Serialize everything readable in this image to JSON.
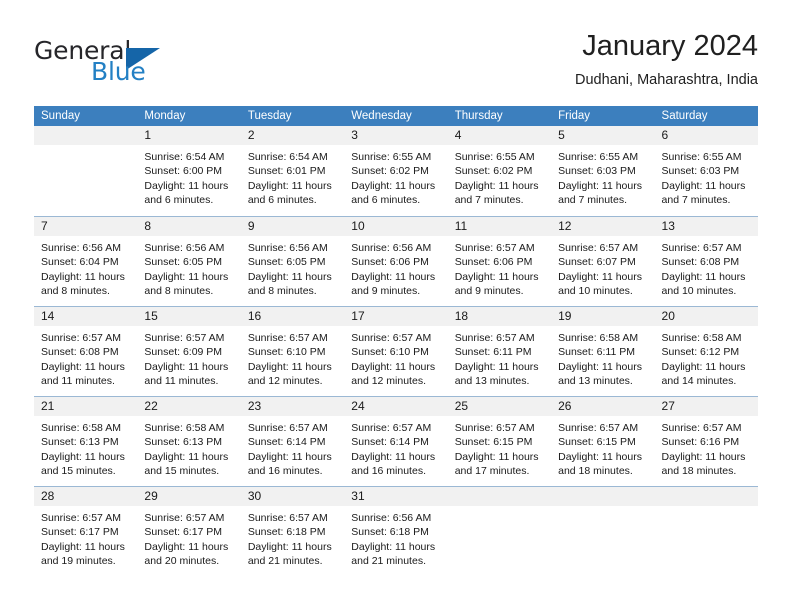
{
  "brand": {
    "name_top": "General",
    "name_bottom": "Blue",
    "accent_color": "#2380c4",
    "triangle_color": "#1565a8"
  },
  "header": {
    "title": "January 2024",
    "subtitle": "Dudhani, Maharashtra, India"
  },
  "calendar": {
    "header_bg": "#3c7fbe",
    "day_band_bg": "#f1f1f1",
    "weekdays": [
      "Sunday",
      "Monday",
      "Tuesday",
      "Wednesday",
      "Thursday",
      "Friday",
      "Saturday"
    ],
    "weeks": [
      [
        {
          "day": "",
          "lines": []
        },
        {
          "day": "1",
          "lines": [
            "Sunrise: 6:54 AM",
            "Sunset: 6:00 PM",
            "Daylight: 11 hours",
            "and 6 minutes."
          ]
        },
        {
          "day": "2",
          "lines": [
            "Sunrise: 6:54 AM",
            "Sunset: 6:01 PM",
            "Daylight: 11 hours",
            "and 6 minutes."
          ]
        },
        {
          "day": "3",
          "lines": [
            "Sunrise: 6:55 AM",
            "Sunset: 6:02 PM",
            "Daylight: 11 hours",
            "and 6 minutes."
          ]
        },
        {
          "day": "4",
          "lines": [
            "Sunrise: 6:55 AM",
            "Sunset: 6:02 PM",
            "Daylight: 11 hours",
            "and 7 minutes."
          ]
        },
        {
          "day": "5",
          "lines": [
            "Sunrise: 6:55 AM",
            "Sunset: 6:03 PM",
            "Daylight: 11 hours",
            "and 7 minutes."
          ]
        },
        {
          "day": "6",
          "lines": [
            "Sunrise: 6:55 AM",
            "Sunset: 6:03 PM",
            "Daylight: 11 hours",
            "and 7 minutes."
          ]
        }
      ],
      [
        {
          "day": "7",
          "lines": [
            "Sunrise: 6:56 AM",
            "Sunset: 6:04 PM",
            "Daylight: 11 hours",
            "and 8 minutes."
          ]
        },
        {
          "day": "8",
          "lines": [
            "Sunrise: 6:56 AM",
            "Sunset: 6:05 PM",
            "Daylight: 11 hours",
            "and 8 minutes."
          ]
        },
        {
          "day": "9",
          "lines": [
            "Sunrise: 6:56 AM",
            "Sunset: 6:05 PM",
            "Daylight: 11 hours",
            "and 8 minutes."
          ]
        },
        {
          "day": "10",
          "lines": [
            "Sunrise: 6:56 AM",
            "Sunset: 6:06 PM",
            "Daylight: 11 hours",
            "and 9 minutes."
          ]
        },
        {
          "day": "11",
          "lines": [
            "Sunrise: 6:57 AM",
            "Sunset: 6:06 PM",
            "Daylight: 11 hours",
            "and 9 minutes."
          ]
        },
        {
          "day": "12",
          "lines": [
            "Sunrise: 6:57 AM",
            "Sunset: 6:07 PM",
            "Daylight: 11 hours",
            "and 10 minutes."
          ]
        },
        {
          "day": "13",
          "lines": [
            "Sunrise: 6:57 AM",
            "Sunset: 6:08 PM",
            "Daylight: 11 hours",
            "and 10 minutes."
          ]
        }
      ],
      [
        {
          "day": "14",
          "lines": [
            "Sunrise: 6:57 AM",
            "Sunset: 6:08 PM",
            "Daylight: 11 hours",
            "and 11 minutes."
          ]
        },
        {
          "day": "15",
          "lines": [
            "Sunrise: 6:57 AM",
            "Sunset: 6:09 PM",
            "Daylight: 11 hours",
            "and 11 minutes."
          ]
        },
        {
          "day": "16",
          "lines": [
            "Sunrise: 6:57 AM",
            "Sunset: 6:10 PM",
            "Daylight: 11 hours",
            "and 12 minutes."
          ]
        },
        {
          "day": "17",
          "lines": [
            "Sunrise: 6:57 AM",
            "Sunset: 6:10 PM",
            "Daylight: 11 hours",
            "and 12 minutes."
          ]
        },
        {
          "day": "18",
          "lines": [
            "Sunrise: 6:57 AM",
            "Sunset: 6:11 PM",
            "Daylight: 11 hours",
            "and 13 minutes."
          ]
        },
        {
          "day": "19",
          "lines": [
            "Sunrise: 6:58 AM",
            "Sunset: 6:11 PM",
            "Daylight: 11 hours",
            "and 13 minutes."
          ]
        },
        {
          "day": "20",
          "lines": [
            "Sunrise: 6:58 AM",
            "Sunset: 6:12 PM",
            "Daylight: 11 hours",
            "and 14 minutes."
          ]
        }
      ],
      [
        {
          "day": "21",
          "lines": [
            "Sunrise: 6:58 AM",
            "Sunset: 6:13 PM",
            "Daylight: 11 hours",
            "and 15 minutes."
          ]
        },
        {
          "day": "22",
          "lines": [
            "Sunrise: 6:58 AM",
            "Sunset: 6:13 PM",
            "Daylight: 11 hours",
            "and 15 minutes."
          ]
        },
        {
          "day": "23",
          "lines": [
            "Sunrise: 6:57 AM",
            "Sunset: 6:14 PM",
            "Daylight: 11 hours",
            "and 16 minutes."
          ]
        },
        {
          "day": "24",
          "lines": [
            "Sunrise: 6:57 AM",
            "Sunset: 6:14 PM",
            "Daylight: 11 hours",
            "and 16 minutes."
          ]
        },
        {
          "day": "25",
          "lines": [
            "Sunrise: 6:57 AM",
            "Sunset: 6:15 PM",
            "Daylight: 11 hours",
            "and 17 minutes."
          ]
        },
        {
          "day": "26",
          "lines": [
            "Sunrise: 6:57 AM",
            "Sunset: 6:15 PM",
            "Daylight: 11 hours",
            "and 18 minutes."
          ]
        },
        {
          "day": "27",
          "lines": [
            "Sunrise: 6:57 AM",
            "Sunset: 6:16 PM",
            "Daylight: 11 hours",
            "and 18 minutes."
          ]
        }
      ],
      [
        {
          "day": "28",
          "lines": [
            "Sunrise: 6:57 AM",
            "Sunset: 6:17 PM",
            "Daylight: 11 hours",
            "and 19 minutes."
          ]
        },
        {
          "day": "29",
          "lines": [
            "Sunrise: 6:57 AM",
            "Sunset: 6:17 PM",
            "Daylight: 11 hours",
            "and 20 minutes."
          ]
        },
        {
          "day": "30",
          "lines": [
            "Sunrise: 6:57 AM",
            "Sunset: 6:18 PM",
            "Daylight: 11 hours",
            "and 21 minutes."
          ]
        },
        {
          "day": "31",
          "lines": [
            "Sunrise: 6:56 AM",
            "Sunset: 6:18 PM",
            "Daylight: 11 hours",
            "and 21 minutes."
          ]
        },
        {
          "day": "",
          "lines": []
        },
        {
          "day": "",
          "lines": []
        },
        {
          "day": "",
          "lines": []
        }
      ]
    ]
  }
}
